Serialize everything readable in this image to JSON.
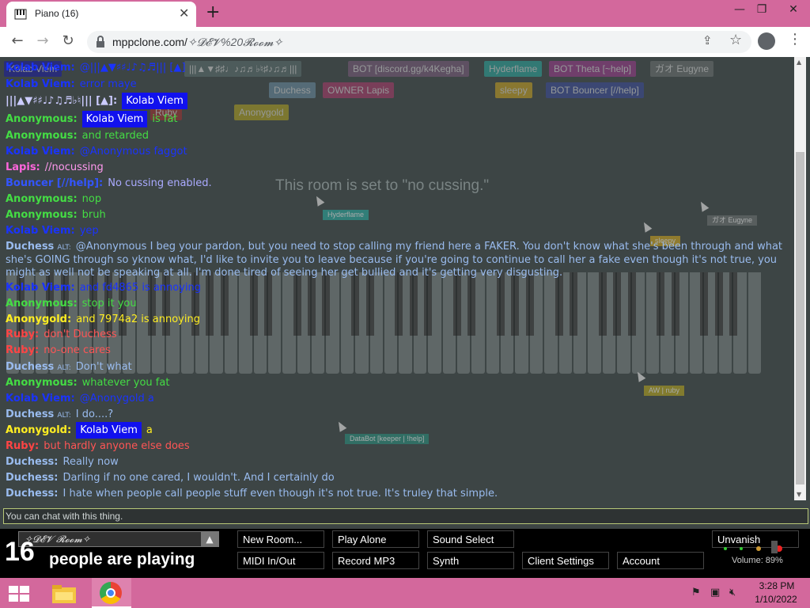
{
  "browser": {
    "tab_title": "Piano (16)",
    "tab_close": "✕",
    "new_tab": "+",
    "window_controls": [
      "—",
      "❐",
      "✕"
    ],
    "nav": {
      "back": "←",
      "forward": "→",
      "reload": "↻"
    },
    "url_host": "mppclone.com/",
    "url_path": "✧𝓓𝓔𝓥%20𝓡𝓸𝓸𝓶✧",
    "menu_glyph": "⋮"
  },
  "room_notice": "This room is set to \"no cussing.\"",
  "participants": [
    {
      "label": "Kolab Viem",
      "color": "#1a1aa0"
    },
    {
      "label": "|||▲▼♯♯♩♪♫♬♭♮♯♪♫♬|||",
      "color": "#5b6e6e"
    },
    {
      "label": "BOT  [discord.gg/k4Kegha]",
      "color": "#7a5a7a"
    },
    {
      "label": "Hyderflame",
      "color": "#2aa59b"
    },
    {
      "label": "BOT  Theta [~help]",
      "color": "#9a3a8a"
    },
    {
      "label": "ガオ Eugyne",
      "color": "#6b6f6f"
    },
    {
      "label": "Duchess",
      "color": "#6a8aa0"
    },
    {
      "label": "OWNER  Lapis",
      "color": "#aa3a6a"
    },
    {
      "label": "BOT  Bouncer [//help]",
      "color": "#3a4a9a"
    },
    {
      "label": "sleepy",
      "color": "#c8a020"
    },
    {
      "label": "Ruby",
      "color": "#a03030"
    },
    {
      "label": "Anonygold",
      "color": "#b0a020"
    }
  ],
  "cursor_tags": [
    {
      "label": "Hyderflame",
      "color": "#2aa59b"
    },
    {
      "label": "ガオ Eugyne",
      "color": "#6b6f6f"
    },
    {
      "label": "sleepy",
      "color": "#c8a020"
    },
    {
      "label": "AW | ruby",
      "color": "#b0a020"
    },
    {
      "label": "DataBot [keeper | !help]",
      "color": "#2a8a7a"
    }
  ],
  "chat": [
    {
      "name": "Kolab Viem:",
      "color": "#1a33ff",
      "text": "@|||▲▼♯♯♩♪♫♬|||  [▲]",
      "text_color": "#1a33ff"
    },
    {
      "name": "Kolab Viem:",
      "color": "#1a33ff",
      "text": "error maye",
      "text_color": "#1a33ff"
    },
    {
      "name": "|||▲▼♯♯♩♪♫♬♭♮||| [▲]:",
      "color": "#ccccff",
      "highlight": "Kolab Viem"
    },
    {
      "name": "Anonymous:",
      "color": "#44dd44",
      "highlight": "Kolab Viem",
      "text": "is fat",
      "text_color": "#44dd44"
    },
    {
      "name": "Anonymous:",
      "color": "#44dd44",
      "text": "and retarded",
      "text_color": "#44dd44"
    },
    {
      "name": "Kolab Viem:",
      "color": "#1a33ff",
      "text": "@Anonymous faggot",
      "text_color": "#1a33ff"
    },
    {
      "name": "Lapis:",
      "color": "#ff66dd",
      "text": "//nocussing",
      "text_color": "#ff99ee"
    },
    {
      "name": "Bouncer [//help]:",
      "color": "#3355ff",
      "text": "No cussing enabled.",
      "text_color": "#aaaaff"
    },
    {
      "name": "Anonymous:",
      "color": "#44dd44",
      "text": "nop",
      "text_color": "#44dd44"
    },
    {
      "name": "Anonymous:",
      "color": "#44dd44",
      "text": "bruh",
      "text_color": "#44dd44"
    },
    {
      "name": "Kolab Viem:",
      "color": "#1a33ff",
      "text": "yep",
      "text_color": "#1a33ff"
    },
    {
      "name": "Duchess",
      "alt": "ALT:",
      "color": "#99bbee",
      "text": "@Anonymous I beg your pardon, but you need to stop calling my friend here a FAKER. You don't know what she's been through and what she's GOING through so yknow what, I'd like to invite you to leave because if you're going to continue to call her a fake even though it's not true, you might as well not be speaking at all. I'm done tired of seeing her get bullied and it's getting very disgusting.",
      "text_color": "#99bbee"
    },
    {
      "name": "Kolab Viem:",
      "color": "#1a33ff",
      "text": "and fd4865 is annoying",
      "text_color": "#1a33ff"
    },
    {
      "name": "Anonymous:",
      "color": "#44dd44",
      "text": "stop it you",
      "text_color": "#44dd44"
    },
    {
      "name": "Anonygold:",
      "color": "#ffee22",
      "text": "and 7974a2 is annoying",
      "text_color": "#ffee22"
    },
    {
      "name": "Ruby:",
      "color": "#ff4444",
      "text": "don't Duchess",
      "text_color": "#ff5555"
    },
    {
      "name": "Ruby:",
      "color": "#ff4444",
      "text": "no-one cares",
      "text_color": "#ff5555"
    },
    {
      "name": "Duchess",
      "alt": "ALT:",
      "color": "#99bbee",
      "text": "Don't what",
      "text_color": "#99bbee"
    },
    {
      "name": "Anonymous:",
      "color": "#44dd44",
      "text": "whatever you fat",
      "text_color": "#44dd44"
    },
    {
      "name": "Kolab Viem:",
      "color": "#1a33ff",
      "text": "@Anonygold a",
      "text_color": "#1a33ff"
    },
    {
      "name": "Duchess",
      "alt": "ALT:",
      "color": "#99bbee",
      "text": "I do....?",
      "text_color": "#99bbee"
    },
    {
      "name": "Anonygold:",
      "color": "#ffee22",
      "highlight": "Kolab Viem",
      "text": "a",
      "text_color": "#ffee22"
    },
    {
      "name": "Ruby:",
      "color": "#ff4444",
      "text": "but hardly anyone else does",
      "text_color": "#ff5555"
    },
    {
      "name": "Duchess:",
      "color": "#99bbee",
      "text": "Really now",
      "text_color": "#99bbee"
    },
    {
      "name": "Duchess:",
      "color": "#99bbee",
      "text": "Darling if no one cared, I wouldn't. And I certainly do",
      "text_color": "#99bbee"
    },
    {
      "name": "Duchess:",
      "color": "#99bbee",
      "text": "I hate when people call people stuff even though it's not true. It's truley that simple.",
      "text_color": "#99bbee"
    }
  ],
  "chat_input_placeholder": "You can chat with this thing.",
  "bottom": {
    "room_name": "✧𝓓𝓔𝓥 𝓡𝓸𝓸𝓶✧",
    "room_arrow": "▲",
    "count": "16",
    "count_label": "people are playing",
    "buttons": {
      "new_room": "New Room...",
      "play_alone": "Play Alone",
      "sound_select": "Sound Select",
      "unvanish": "Unvanish",
      "midi": "MIDI In/Out",
      "record": "Record MP3",
      "synth": "Synth",
      "client_settings": "Client Settings",
      "account": "Account"
    },
    "volume": "Volume: 89%"
  },
  "taskbar": {
    "time": "3:28 PM",
    "date": "1/10/2022"
  }
}
